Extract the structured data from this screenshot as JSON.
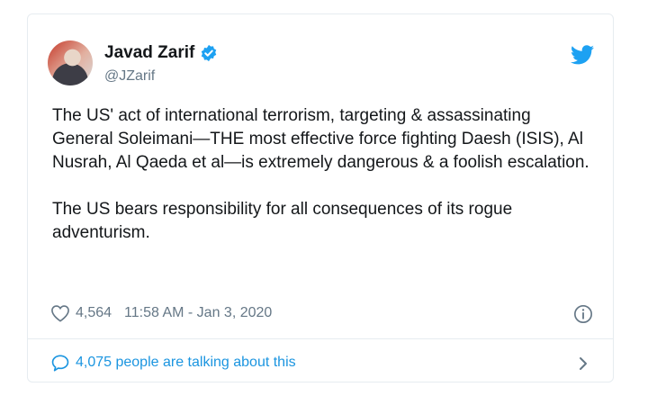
{
  "tweet": {
    "author_name": "Javad Zarif",
    "handle": "@JZarif",
    "paragraphs": [
      "The US' act of international terrorism, targeting & assassinating General Soleimani—THE most effective force fighting Daesh (ISIS), Al Nusrah, Al Qaeda et al—is extremely dangerous & a foolish escalation.",
      "The US bears responsibility for all consequences of its rogue adventurism."
    ],
    "likes": "4,564",
    "timestamp": "11:58 AM - Jan 3, 2020",
    "talking": "4,075 people are talking about this"
  },
  "icons": {
    "verified": "verified-badge-icon",
    "bird": "twitter-bird-icon",
    "heart": "heart-icon",
    "info": "info-icon",
    "bubble": "speech-bubble-icon",
    "chevron": "chevron-right-icon"
  },
  "colors": {
    "brand_blue": "#1da1f2",
    "link_blue": "#1b95e0",
    "text": "#14171a",
    "muted": "#657786"
  }
}
